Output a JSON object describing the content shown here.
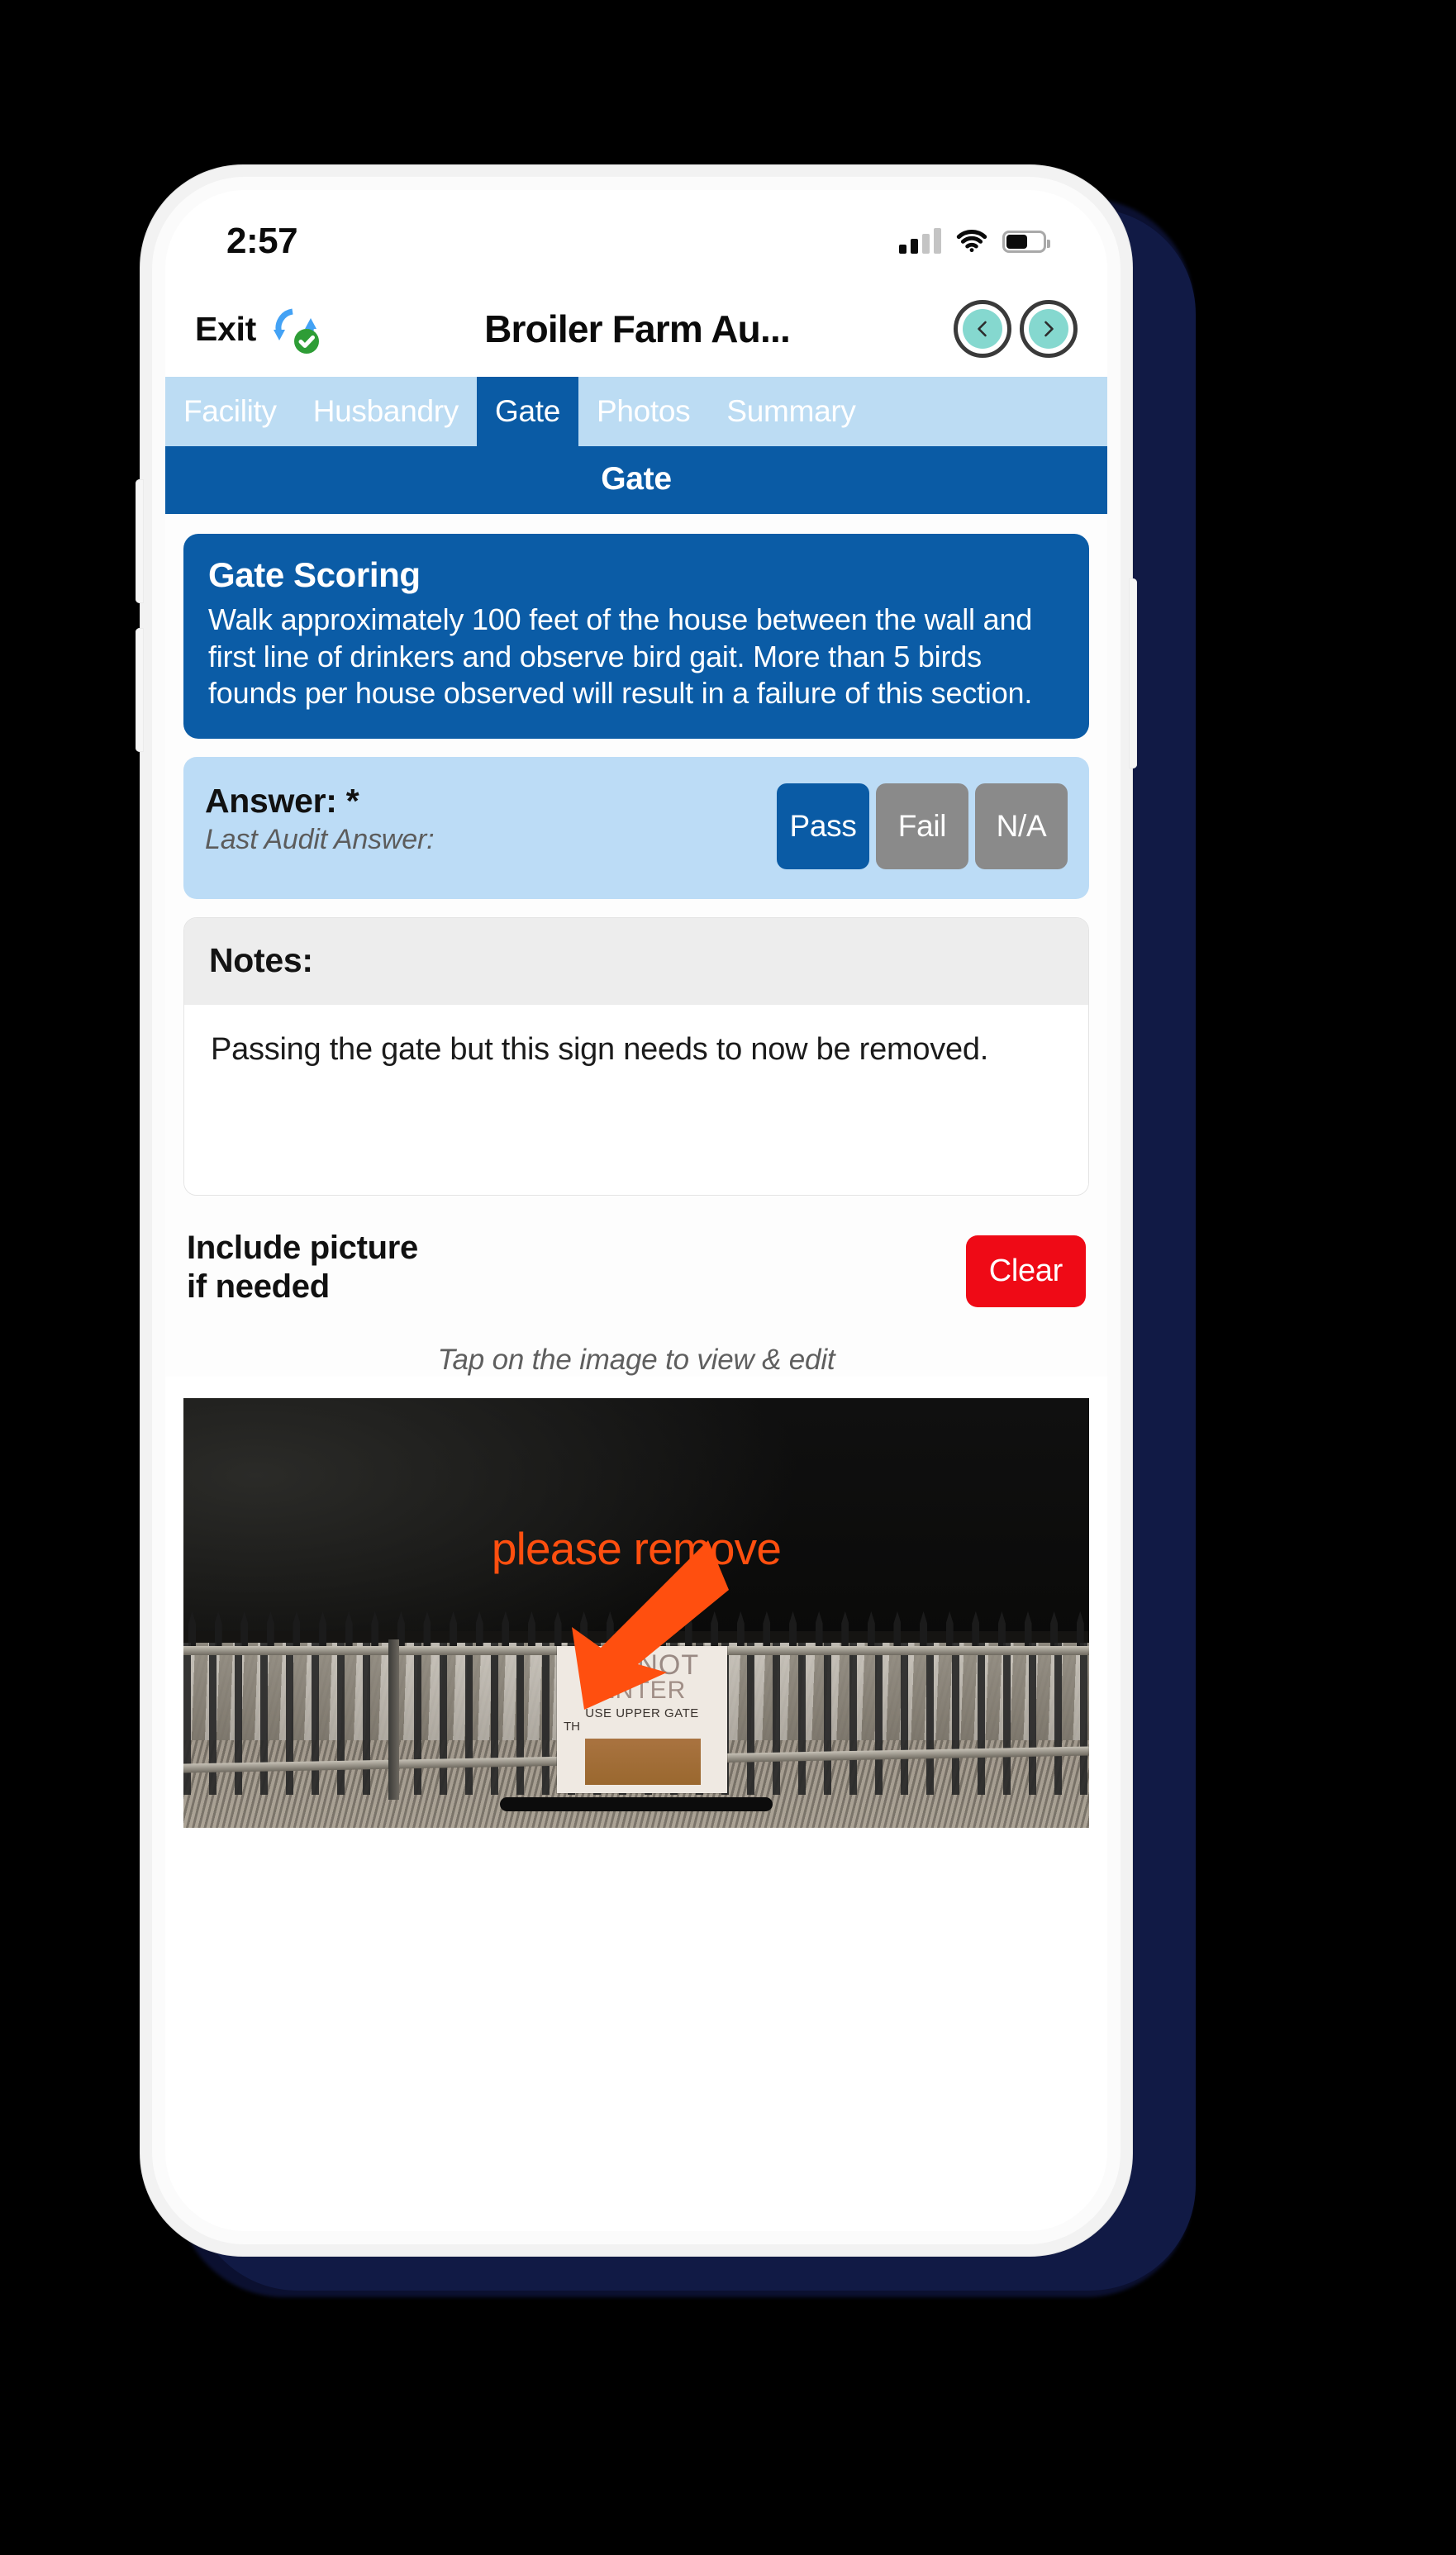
{
  "status_bar": {
    "time": "2:57",
    "signal_icon": "cellular-signal-icon",
    "wifi_icon": "wifi-icon",
    "battery_icon": "battery-icon",
    "battery_level_percent": 58
  },
  "nav_bar": {
    "exit_label": "Exit",
    "sync_icon": "sync-complete-icon",
    "title": "Broiler Farm Au...",
    "prev_icon": "chevron-left-icon",
    "next_icon": "chevron-right-icon"
  },
  "tabs": {
    "items": [
      {
        "label": "Facility",
        "active": false
      },
      {
        "label": "Husbandry",
        "active": false
      },
      {
        "label": "Gate",
        "active": true
      },
      {
        "label": "Photos",
        "active": false
      },
      {
        "label": "Summary",
        "active": false
      }
    ]
  },
  "section": {
    "header": "Gate"
  },
  "scoring_card": {
    "title": "Gate Scoring",
    "body": "Walk approximately 100 feet of the house between the wall and first line of drinkers and observe bird gait. More than 5 birds founds per house observed will result in a failure of this section."
  },
  "answer": {
    "label": "Answer: *",
    "last_audit_label": "Last Audit Answer:",
    "last_audit_value": "",
    "options": [
      {
        "label": "Pass",
        "selected": true
      },
      {
        "label": "Fail",
        "selected": false
      },
      {
        "label": "N/A",
        "selected": false
      }
    ]
  },
  "notes": {
    "header": "Notes:",
    "value": "Passing the gate but this sign needs to now be removed.",
    "placeholder": ""
  },
  "picture": {
    "label_line1": "Include picture",
    "label_line2": "if needed",
    "clear_label": "Clear",
    "tap_hint": "Tap on the image to view & edit",
    "annotation_text": "please remove",
    "annotation_arrow_icon": "arrow-down-left-icon",
    "sign_line1": "DO NOT",
    "sign_line2": "ENTER",
    "sign_line3": "USE UPPER GATE",
    "sign_line4": "TH"
  },
  "colors": {
    "primary_blue": "#0a5ba5",
    "light_blue": "#bcdcf3",
    "answer_panel_blue": "#bcdcf6",
    "muted_gray": "#8a8a8a",
    "clear_red": "#ef0a16",
    "teal_accent": "#85d8cf",
    "annotation_orange": "#ff4f0f",
    "notes_header_gray": "#ededed"
  }
}
